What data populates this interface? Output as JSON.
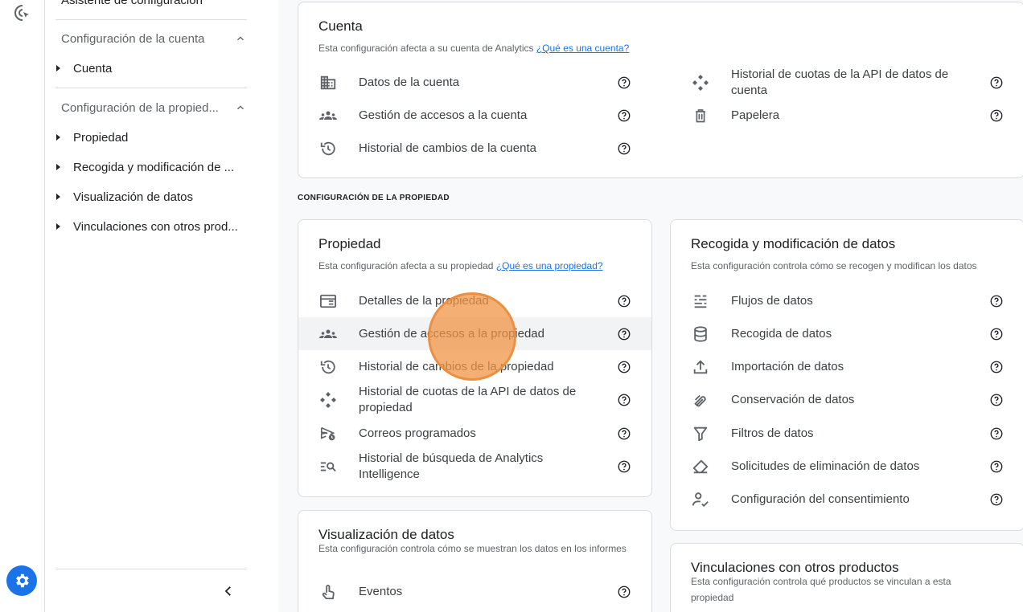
{
  "sidebar": {
    "top_item": "Asistente de configuración",
    "account_section": "Configuración de la cuenta",
    "account_items": [
      "Cuenta"
    ],
    "property_section": "Configuración de la propied...",
    "property_items": [
      "Propiedad",
      "Recogida y modificación de ...",
      "Visualización de datos",
      "Vinculaciones con otros prod..."
    ]
  },
  "account_card": {
    "title": "Cuenta",
    "desc": "Esta configuración afecta a su cuenta de Analytics ",
    "desc_link": "¿Qué es una cuenta?",
    "left_items": [
      "Datos de la cuenta",
      "Gestión de accesos a la cuenta",
      "Historial de cambios de la cuenta"
    ],
    "right_items": [
      "Historial de cuotas de la API de datos de cuenta",
      "Papelera"
    ]
  },
  "property_section_label": "CONFIGURACIÓN DE LA PROPIEDAD",
  "property_card": {
    "title": "Propiedad",
    "desc": "Esta configuración afecta a su propiedad ",
    "desc_link": "¿Qué es una propiedad?",
    "items": [
      "Detalles de la propiedad",
      "Gestión de accesos a la propiedad",
      "Historial de cambios de la propiedad",
      "Historial de cuotas de la API de datos de propiedad",
      "Correos programados",
      "Historial de búsqueda de Analytics Intelligence"
    ]
  },
  "collection_card": {
    "title": "Recogida y modificación de datos",
    "desc": "Esta configuración controla cómo se recogen y modifican los datos",
    "items": [
      "Flujos de datos",
      "Recogida de datos",
      "Importación de datos",
      "Conservación de datos",
      "Filtros de datos",
      "Solicitudes de eliminación de datos",
      "Configuración del consentimiento"
    ]
  },
  "display_card": {
    "title": "Visualización de datos",
    "desc": "Esta configuración controla cómo se muestran los datos en los informes",
    "items": [
      "Eventos"
    ]
  },
  "links_card": {
    "title": "Vinculaciones con otros productos",
    "desc": "Esta configuración controla qué productos se vinculan a esta propiedad"
  },
  "icons": {
    "logo": "analytics-logo-icon",
    "settings": "gear-icon",
    "help": "help-circle-icon",
    "collapse": "chevron-left-icon"
  },
  "colors": {
    "accent": "#1a73e8",
    "click_marker": "#f0964a"
  }
}
